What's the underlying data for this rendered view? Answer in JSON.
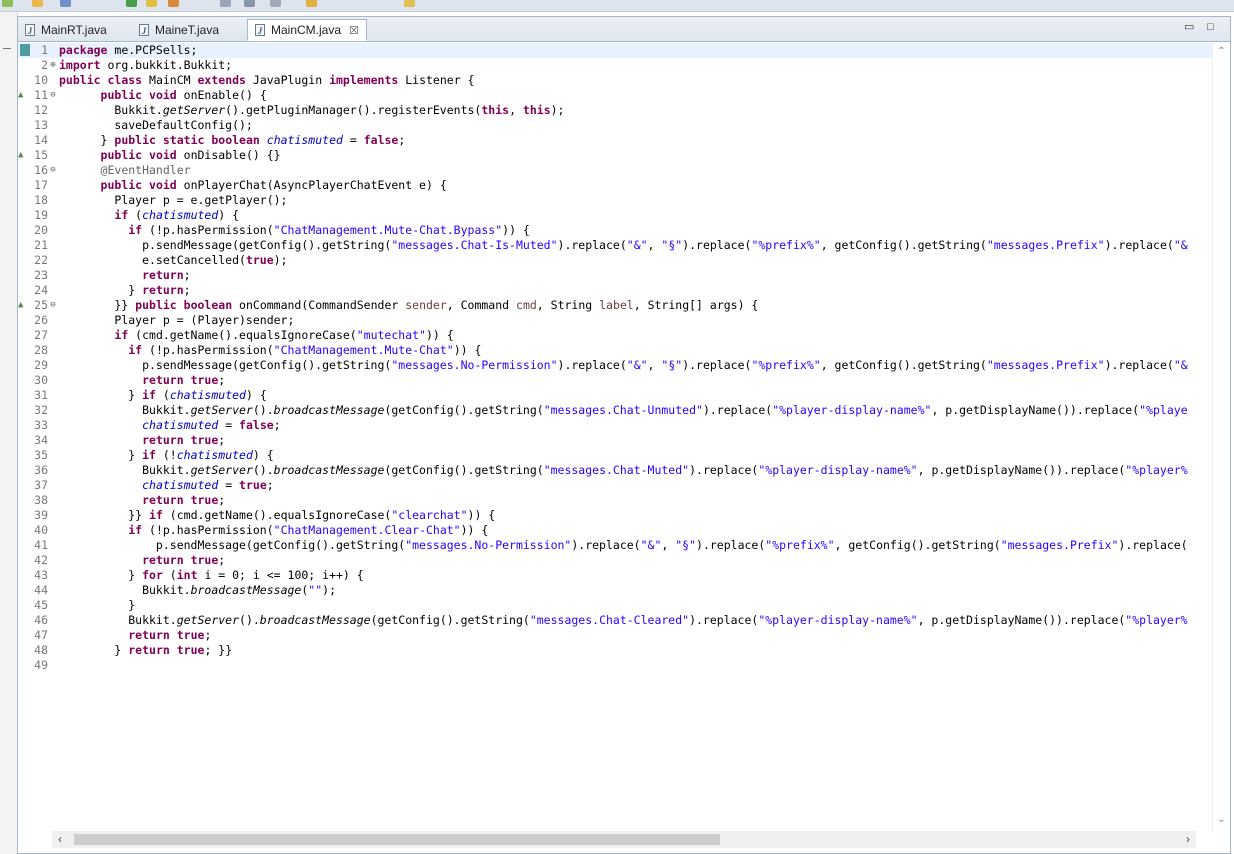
{
  "tabs": [
    {
      "label": "MainRT.java",
      "active": false
    },
    {
      "label": "MaineT.java",
      "active": false
    },
    {
      "label": "MainCM.java",
      "active": true
    }
  ],
  "window_controls": {
    "minimize": "▭",
    "maximize": "□"
  },
  "tab_close_glyph": "☒",
  "file_icon_glyph": "J",
  "colors": {
    "keyword": "#7f0055",
    "string": "#2a00ff",
    "field": "#0000c0",
    "annotation": "#646464",
    "current_line": "#e8f2fe"
  },
  "code_lines": [
    {
      "n": "1",
      "text": "package me.PCPSells;"
    },
    {
      "n": "2",
      "text": "import org.bukkit.Bukkit;"
    },
    {
      "n": "10",
      "text": "public class MainCM extends JavaPlugin implements Listener {"
    },
    {
      "n": "11",
      "text": "      public void onEnable() {"
    },
    {
      "n": "12",
      "text": "        Bukkit.getServer().getPluginManager().registerEvents(this, this);"
    },
    {
      "n": "13",
      "text": "        saveDefaultConfig();"
    },
    {
      "n": "14",
      "text": "      } public static boolean chatismuted = false;"
    },
    {
      "n": "15",
      "text": "      public void onDisable() {}"
    },
    {
      "n": "16",
      "text": "      @EventHandler"
    },
    {
      "n": "17",
      "text": "      public void onPlayerChat(AsyncPlayerChatEvent e) {"
    },
    {
      "n": "18",
      "text": "        Player p = e.getPlayer();"
    },
    {
      "n": "19",
      "text": "        if (chatismuted) {"
    },
    {
      "n": "20",
      "text": "          if (!p.hasPermission(\"ChatManagement.Mute-Chat.Bypass\")) {"
    },
    {
      "n": "21",
      "text": "            p.sendMessage(getConfig().getString(\"messages.Chat-Is-Muted\").replace(\"&\", \"§\").replace(\"%prefix%\", getConfig().getString(\"messages.Prefix\").replace(\"&"
    },
    {
      "n": "22",
      "text": "            e.setCancelled(true);"
    },
    {
      "n": "23",
      "text": "            return;"
    },
    {
      "n": "24",
      "text": "          } return;"
    },
    {
      "n": "25",
      "text": "        }} public boolean onCommand(CommandSender sender, Command cmd, String label, String[] args) {"
    },
    {
      "n": "26",
      "text": "        Player p = (Player)sender;"
    },
    {
      "n": "27",
      "text": "        if (cmd.getName().equalsIgnoreCase(\"mutechat\")) {"
    },
    {
      "n": "28",
      "text": "          if (!p.hasPermission(\"ChatManagement.Mute-Chat\")) {"
    },
    {
      "n": "29",
      "text": "            p.sendMessage(getConfig().getString(\"messages.No-Permission\").replace(\"&\", \"§\").replace(\"%prefix%\", getConfig().getString(\"messages.Prefix\").replace(\"&"
    },
    {
      "n": "30",
      "text": "            return true;"
    },
    {
      "n": "31",
      "text": "          } if (chatismuted) {"
    },
    {
      "n": "32",
      "text": "            Bukkit.getServer().broadcastMessage(getConfig().getString(\"messages.Chat-Unmuted\").replace(\"%player-display-name%\", p.getDisplayName()).replace(\"%playe"
    },
    {
      "n": "33",
      "text": "            chatismuted = false;"
    },
    {
      "n": "34",
      "text": "            return true;"
    },
    {
      "n": "35",
      "text": "          } if (!chatismuted) {"
    },
    {
      "n": "36",
      "text": "            Bukkit.getServer().broadcastMessage(getConfig().getString(\"messages.Chat-Muted\").replace(\"%player-display-name%\", p.getDisplayName()).replace(\"%player%"
    },
    {
      "n": "37",
      "text": "            chatismuted = true;"
    },
    {
      "n": "38",
      "text": "            return true;"
    },
    {
      "n": "39",
      "text": "          }} if (cmd.getName().equalsIgnoreCase(\"clearchat\")) {"
    },
    {
      "n": "40",
      "text": "          if (!p.hasPermission(\"ChatManagement.Clear-Chat\")) {"
    },
    {
      "n": "41",
      "text": "              p.sendMessage(getConfig().getString(\"messages.No-Permission\").replace(\"&\", \"§\").replace(\"%prefix%\", getConfig().getString(\"messages.Prefix\").replace("
    },
    {
      "n": "42",
      "text": "            return true;"
    },
    {
      "n": "43",
      "text": "          } for (int i = 0; i <= 100; i++) {"
    },
    {
      "n": "44",
      "text": "            Bukkit.broadcastMessage(\"\");"
    },
    {
      "n": "45",
      "text": "          }"
    },
    {
      "n": "46",
      "text": "          Bukkit.getServer().broadcastMessage(getConfig().getString(\"messages.Chat-Cleared\").replace(\"%player-display-name%\", p.getDisplayName()).replace(\"%player%"
    },
    {
      "n": "47",
      "text": "          return true;"
    },
    {
      "n": "48",
      "text": "        } return true; }}"
    },
    {
      "n": "49",
      "text": ""
    }
  ]
}
